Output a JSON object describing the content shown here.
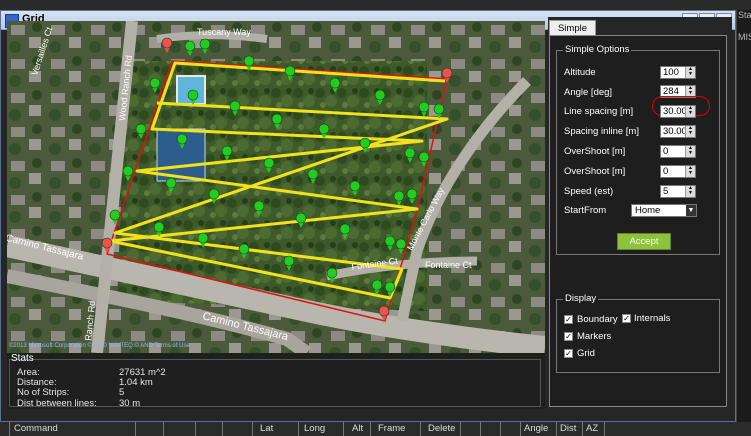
{
  "window": {
    "title": "Grid"
  },
  "map": {
    "roads": [
      {
        "name": "Camino Tassajara"
      },
      {
        "name": "Camino Tassajara"
      },
      {
        "name": "Fontaine Ct"
      },
      {
        "name": "Monte Carlo Way"
      },
      {
        "name": "Wood Ranch Rd"
      },
      {
        "name": "Versailles Ct"
      },
      {
        "name": "Ranch Rd"
      },
      {
        "name": "Tuscany Way"
      }
    ],
    "copyright": "©2013 Microsoft Corporation © 2010 NAVTEQ © AND  Terms of Use"
  },
  "stats": {
    "legend": "Stats",
    "rows": [
      {
        "label": "Area:",
        "value": "27631 m^2"
      },
      {
        "label": "Distance:",
        "value": "1.04 km"
      },
      {
        "label": "No of Strips:",
        "value": "5"
      },
      {
        "label": "Dist between lines:",
        "value": "30 m"
      }
    ]
  },
  "panel": {
    "tab": "Simple",
    "simple_options": {
      "legend": "Simple Options",
      "altitude": {
        "label": "Altitude",
        "value": "100"
      },
      "angle": {
        "label": "Angle [deg]",
        "value": "284"
      },
      "line_spacing": {
        "label": "Line spacing [m]",
        "value": "30.00"
      },
      "spacing_inline": {
        "label": "Spacing inline [m]",
        "value": "30.00"
      },
      "overshoot1": {
        "label": "OverShoot [m]",
        "value": "0"
      },
      "overshoot2": {
        "label": "OverShoot [m]",
        "value": "0"
      },
      "speed": {
        "label": "Speed (est)",
        "value": "5"
      },
      "start_from": {
        "label": "StartFrom",
        "value": "Home"
      },
      "accept": "Accept"
    },
    "display": {
      "legend": "Display",
      "boundary": "Boundary",
      "internals": "Internals",
      "markers": "Markers",
      "grid": "Grid"
    }
  },
  "right_strip": {
    "top": "Sta",
    "second": "MIS"
  },
  "bottom_bar": {
    "cols": [
      "Command",
      "Lat",
      "Long",
      "Alt",
      "Frame",
      "Delete",
      "Angle",
      "Dist",
      "AZ"
    ]
  },
  "colors": {
    "boundary": "#e01010",
    "grid": "#f2e21c",
    "marker": "#22cc22",
    "corner_marker": "#f05050",
    "accept": "#8ec23c"
  }
}
